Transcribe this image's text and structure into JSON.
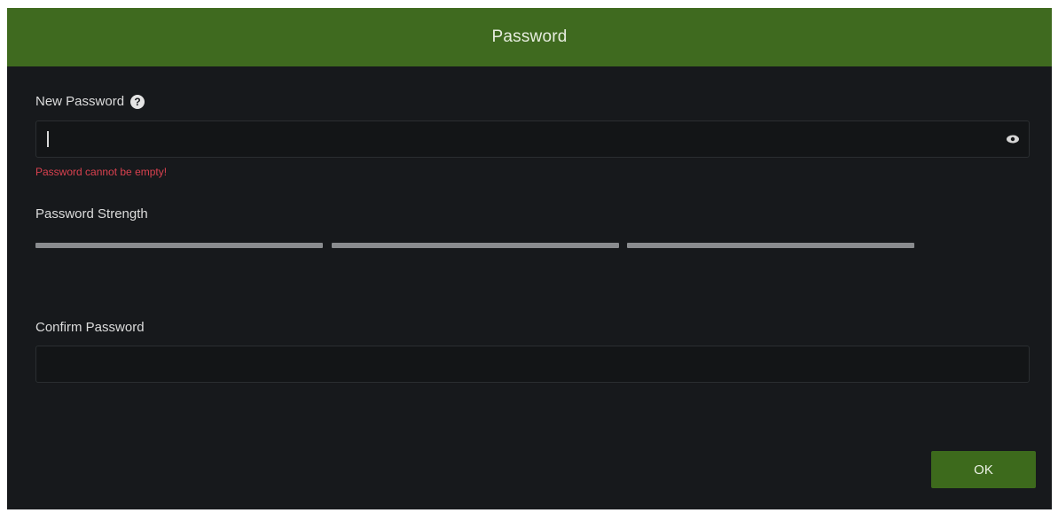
{
  "dialog": {
    "title": "Password",
    "new_password": {
      "label": "New Password",
      "value": "",
      "error": "Password cannot be empty!"
    },
    "strength": {
      "label": "Password Strength",
      "segments": 3,
      "level": 0
    },
    "confirm_password": {
      "label": "Confirm Password",
      "value": ""
    },
    "ok_label": "OK"
  },
  "icons": {
    "help": "help-circle-icon",
    "toggle_visibility": "eye-icon"
  },
  "colors": {
    "header": "#3f6a1f",
    "background": "#17191c",
    "error": "#d9414f",
    "strength_bar": "#8a8c8f",
    "button": "#3d6a1c"
  }
}
